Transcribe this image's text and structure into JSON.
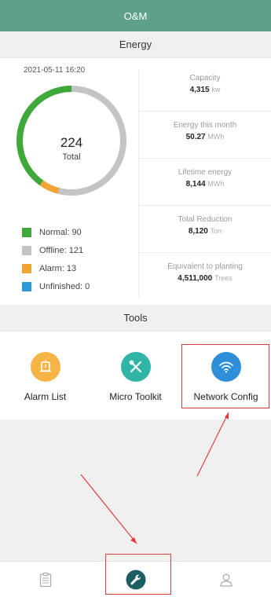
{
  "header": {
    "title": "O&M"
  },
  "energy": {
    "section_title": "Energy",
    "timestamp": "2021-05-11 16:20",
    "total_value": "224",
    "total_label": "Total",
    "legend": [
      {
        "label": "Normal: 90",
        "color": "#3ea83a"
      },
      {
        "label": "Offline: 121",
        "color": "#c4c4c4"
      },
      {
        "label": "Alarm: 13",
        "color": "#f0a431"
      },
      {
        "label": "Unfinished: 0",
        "color": "#2d9ad8"
      }
    ],
    "stats": [
      {
        "label": "Capacity",
        "value": "4,315",
        "unit": "kw"
      },
      {
        "label": "Energy this month",
        "value": "50.27",
        "unit": "MWh"
      },
      {
        "label": "Lifetime energy",
        "value": "8,144",
        "unit": "MWh"
      },
      {
        "label": "Total Reduction",
        "value": "8,120",
        "unit": "Ton"
      },
      {
        "label": "Equivalent to planting",
        "value": "4,511,000",
        "unit": "Trees"
      }
    ]
  },
  "tools": {
    "section_title": "Tools",
    "items": [
      {
        "label": "Alarm List",
        "icon": "alarm-icon",
        "color": "#f5b445"
      },
      {
        "label": "Micro Toolkit",
        "icon": "tools-icon",
        "color": "#30b4a6"
      },
      {
        "label": "Network Config",
        "icon": "wifi-icon",
        "color": "#2e8fd8"
      }
    ]
  },
  "tabbar": {
    "items": [
      {
        "icon": "clipboard-icon",
        "active": false
      },
      {
        "icon": "wrench-icon",
        "active": true,
        "color": "#1d5e63"
      },
      {
        "icon": "user-icon",
        "active": false
      }
    ]
  },
  "colors": {
    "header": "#5fa08c",
    "annotation": "#e23a3a"
  }
}
